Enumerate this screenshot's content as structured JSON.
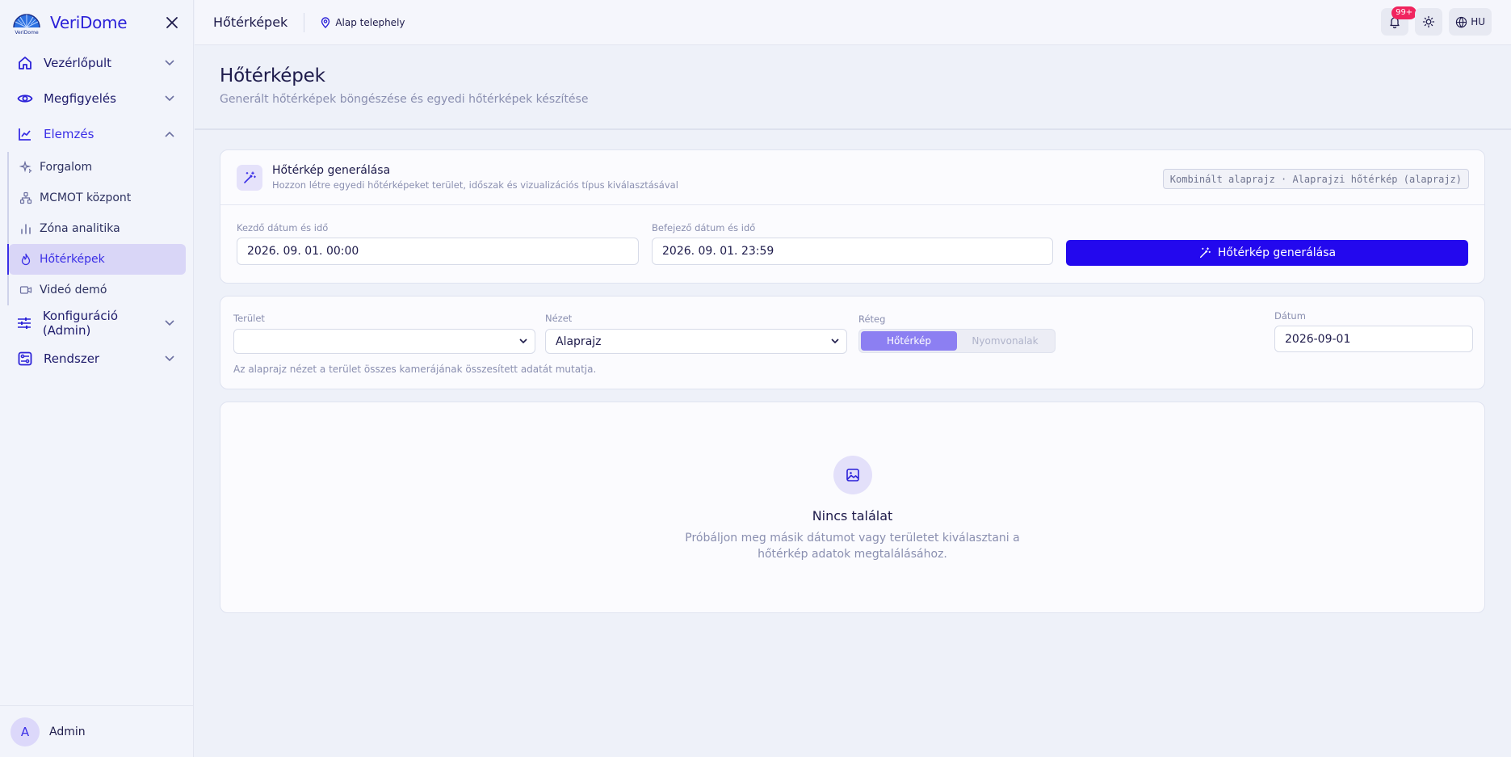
{
  "brand": {
    "name": "VeriDome",
    "logo_text": "VeriDome"
  },
  "sidebar": {
    "items": [
      {
        "label": "Vezérlőpult",
        "icon": "home-icon"
      },
      {
        "label": "Megfigyelés",
        "icon": "eye-icon"
      },
      {
        "label": "Elemzés",
        "icon": "chart-line-icon"
      },
      {
        "label": "Konfiguráció (Admin)",
        "icon": "sliders-icon"
      },
      {
        "label": "Rendszer",
        "icon": "system-icon"
      }
    ],
    "subitems": [
      {
        "label": "Forgalom",
        "icon": "sparkles-icon"
      },
      {
        "label": "MCMOT központ",
        "icon": "network-icon"
      },
      {
        "label": "Zóna analitika",
        "icon": "bar-chart-icon"
      },
      {
        "label": "Hőtérképek",
        "icon": "flame-icon"
      },
      {
        "label": "Videó demó",
        "icon": "video-icon"
      }
    ],
    "user": {
      "initial": "A",
      "name": "Admin"
    }
  },
  "topbar": {
    "title": "Hőtérképek",
    "site": "Alap telephely",
    "notification_badge": "99+",
    "lang": "HU"
  },
  "page": {
    "title": "Hőtérképek",
    "subtitle": "Generált hőtérképek böngészése és egyedi hőtérképek készítése"
  },
  "generate": {
    "title": "Hőtérkép generálása",
    "desc": "Hozzon létre egyedi hőtérképeket terület, időszak és vizualizációs típus kiválasztásával",
    "chip": "Kombinált alaprajz · Alaprajzi hőtérkép (alaprajz)",
    "start_label": "Kezdő dátum és idő",
    "start_value": "2026. 09. 01. 00:00",
    "end_label": "Befejező dátum és idő",
    "end_value": "2026. 09. 01. 23:59",
    "button": "Hőtérkép generálása"
  },
  "filters": {
    "area_label": "Terület",
    "area_value": "",
    "view_label": "Nézet",
    "view_value": "Alaprajz",
    "layer_label": "Réteg",
    "layer_options": [
      "Hőtérkép",
      "Nyomvonalak"
    ],
    "date_label": "Dátum",
    "date_value": "2026-09-01",
    "hint": "Az alaprajz nézet a terület összes kamerájának összesített adatát mutatja."
  },
  "empty": {
    "title": "Nincs találat",
    "desc": "Próbáljon meg másik dátumot vagy területet kiválasztani a hőtérkép adatok megtalálásához."
  },
  "colors": {
    "accent": "#2308ee",
    "brand": "#2b21d8",
    "badge": "#f0245e",
    "toggle_active": "#8c7ff2"
  }
}
